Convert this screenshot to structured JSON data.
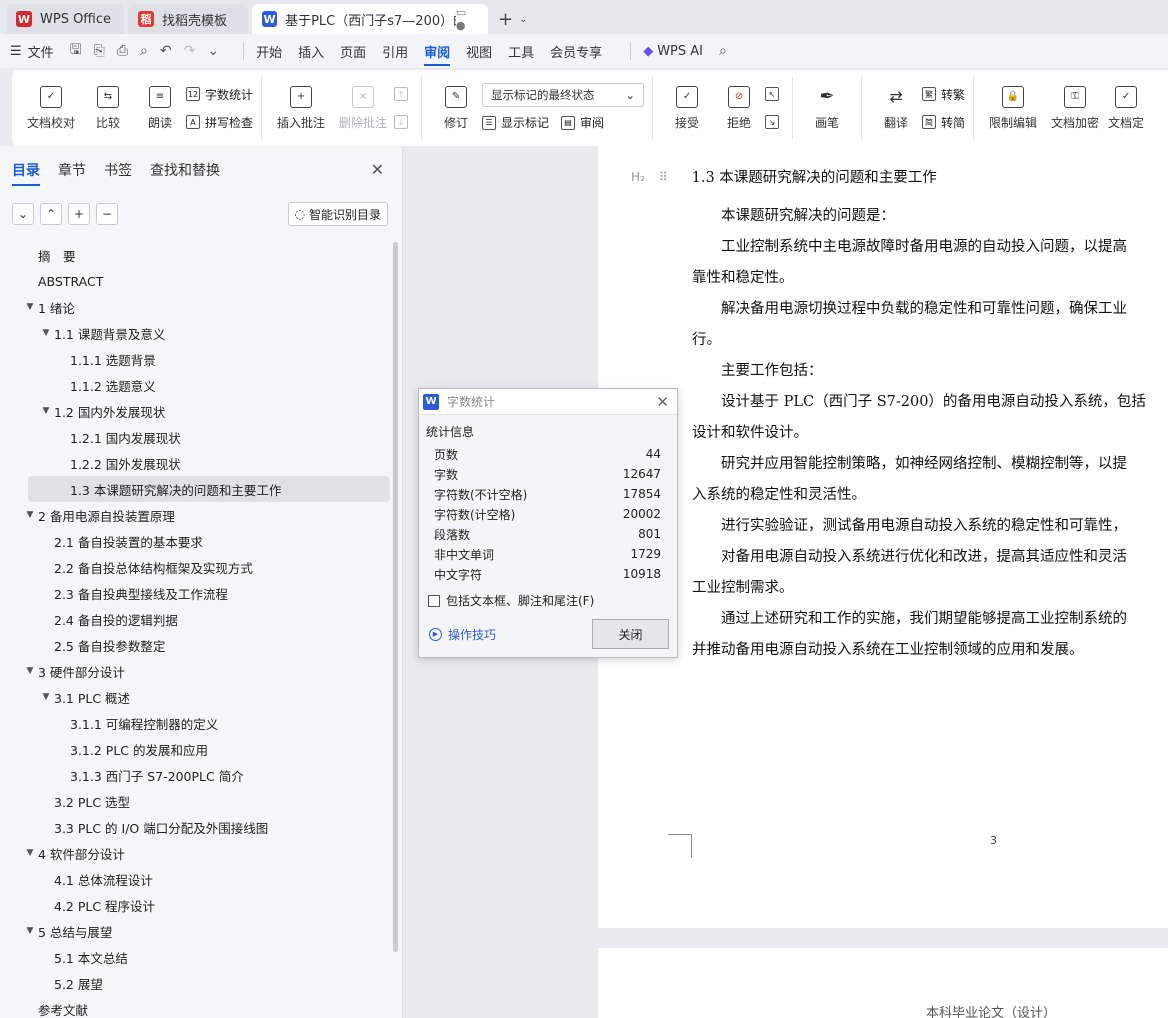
{
  "tabs": [
    {
      "label": "WPS Office",
      "icon": "wps-logo-icon",
      "color": "#d9262c"
    },
    {
      "label": "找稻壳模板",
      "icon": "docer-icon",
      "color": "#e8362f"
    },
    {
      "label": "基于PLC（西门子s7—200）的",
      "icon": "writer-doc-icon",
      "color": "#2c5cdb"
    }
  ],
  "new_tab_label": "+",
  "menubar": {
    "file_label": "文件",
    "items": [
      "开始",
      "插入",
      "页面",
      "引用",
      "审阅",
      "视图",
      "工具",
      "会员专享"
    ],
    "active": "审阅",
    "wps_ai_label": "WPS AI"
  },
  "ribbon": {
    "doc_check": "文档校对",
    "compare": "比较",
    "read_aloud": "朗读",
    "word_count": "字数统计",
    "spell_check": "拼写检查",
    "insert_comment": "插入批注",
    "delete_comment": "删除批注",
    "revise": "修订",
    "markup_state": "显示标记的最终状态",
    "show_markup": "显示标记",
    "review": "审阅",
    "accept": "接受",
    "reject": "拒绝",
    "pen": "画笔",
    "translate": "翻译",
    "to_traditional": "转繁",
    "to_simplified": "转简",
    "restrict_edit": "限制编辑",
    "doc_encrypt": "文档加密",
    "doc_finalize": "文档定"
  },
  "nav": {
    "tabs": [
      "目录",
      "章节",
      "书签",
      "查找和替换"
    ],
    "active_tab": "目录",
    "smart_toc_label": "智能识别目录",
    "toc": [
      {
        "text": "摘　要",
        "level": 0,
        "caret": ""
      },
      {
        "text": "ABSTRACT",
        "level": 0,
        "caret": ""
      },
      {
        "text": "1  绪论",
        "level": 0,
        "caret": "▼"
      },
      {
        "text": "1.1  课题背景及意义",
        "level": 1,
        "caret": "▼"
      },
      {
        "text": "1.1.1  选题背景",
        "level": 2,
        "caret": ""
      },
      {
        "text": "1.1.2  选题意义",
        "level": 2,
        "caret": ""
      },
      {
        "text": "1.2  国内外发展现状",
        "level": 1,
        "caret": "▼"
      },
      {
        "text": "1.2.1  国内发展现状",
        "level": 2,
        "caret": ""
      },
      {
        "text": "1.2.2  国外发展现状",
        "level": 2,
        "caret": ""
      },
      {
        "text": "1.3  本课题研究解决的问题和主要工作",
        "level": 1,
        "caret": "",
        "selected": true
      },
      {
        "text": "2  备用电源自投装置原理",
        "level": 0,
        "caret": "▼"
      },
      {
        "text": "2.1  备自投装置的基本要求",
        "level": 1,
        "caret": ""
      },
      {
        "text": "2.2  备自投总体结构框架及实现方式",
        "level": 1,
        "caret": ""
      },
      {
        "text": "2.3  备自投典型接线及工作流程",
        "level": 1,
        "caret": ""
      },
      {
        "text": "2.4  备自投的逻辑判据",
        "level": 1,
        "caret": ""
      },
      {
        "text": "2.5  备自投参数整定",
        "level": 1,
        "caret": ""
      },
      {
        "text": "3  硬件部分设计",
        "level": 0,
        "caret": "▼"
      },
      {
        "text": "3.1 PLC 概述",
        "level": 1,
        "caret": "▼"
      },
      {
        "text": "3.1.1  可编程控制器的定义",
        "level": 2,
        "caret": ""
      },
      {
        "text": "3.1.2 PLC 的发展和应用",
        "level": 2,
        "caret": ""
      },
      {
        "text": "3.1.3  西门子 S7-200PLC 简介",
        "level": 2,
        "caret": ""
      },
      {
        "text": "3.2 PLC 选型",
        "level": 1,
        "caret": ""
      },
      {
        "text": "3.3 PLC 的 I/O 端口分配及外围接线图",
        "level": 1,
        "caret": ""
      },
      {
        "text": "4  软件部分设计",
        "level": 0,
        "caret": "▼"
      },
      {
        "text": "4.1  总体流程设计",
        "level": 1,
        "caret": ""
      },
      {
        "text": "4.2 PLC 程序设计",
        "level": 1,
        "caret": ""
      },
      {
        "text": "5  总结与展望",
        "level": 0,
        "caret": "▼"
      },
      {
        "text": "5.1  本文总结",
        "level": 1,
        "caret": ""
      },
      {
        "text": "5.2  展望",
        "level": 1,
        "caret": ""
      },
      {
        "text": "参考文献",
        "level": 0,
        "caret": ""
      }
    ]
  },
  "document": {
    "heading_mark": "H₂",
    "heading": "1.3  本课题研究解决的问题和主要工作",
    "lines": [
      "　　本课题研究解决的问题是：",
      "　　工业控制系统中主电源故障时备用电源的自动投入问题，以提高",
      "靠性和稳定性。",
      "　　解决备用电源切换过程中负载的稳定性和可靠性问题，确保工业",
      "行。",
      "　　主要工作包括：",
      "　　设计基于 PLC（西门子 S7-200）的备用电源自动投入系统，包括",
      "设计和软件设计。",
      "　　研究并应用智能控制策略，如神经网络控制、模糊控制等，以提",
      "入系统的稳定性和灵活性。",
      "　　进行实验验证，测试备用电源自动投入系统的稳定性和可靠性，",
      "　　对备用电源自动投入系统进行优化和改进，提高其适应性和灵活",
      "工业控制需求。",
      "　　通过上述研究和工作的实施，我们期望能够提高工业控制系统的",
      "并推动备用电源自动投入系统在工业控制领域的应用和发展。"
    ],
    "page_number": "3",
    "next_page_footer": "本科毕业论文（设计）"
  },
  "dialog": {
    "title": "字数统计",
    "section_label": "统计信息",
    "stats": [
      {
        "label": "页数",
        "value": "44"
      },
      {
        "label": "字数",
        "value": "12647"
      },
      {
        "label": "字符数(不计空格)",
        "value": "17854"
      },
      {
        "label": "字符数(计空格)",
        "value": "20002"
      },
      {
        "label": "段落数",
        "value": "801"
      },
      {
        "label": "非中文单词",
        "value": "1729"
      },
      {
        "label": "中文字符",
        "value": "10918"
      }
    ],
    "checkbox_label": "包括文本框、脚注和尾注(F)",
    "tips_label": "操作技巧",
    "close_label": "关闭"
  },
  "colors": {
    "accent": "#1a5cd8",
    "wps_red": "#d9262c"
  }
}
